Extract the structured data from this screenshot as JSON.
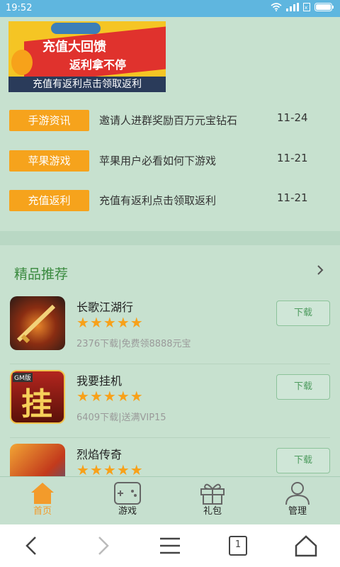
{
  "status_bar": {
    "time": "19:52"
  },
  "banner": {
    "headline_1": "充值大回馈",
    "headline_2": "返利拿不停",
    "caption": "充值有返利点击领取返利"
  },
  "news": [
    {
      "tag": "手游资讯",
      "title": "邀请人进群奖励百万元宝钻石",
      "date": "11-24"
    },
    {
      "tag": "苹果游戏",
      "title": "苹果用户必看如何下游戏",
      "date": "11-21"
    },
    {
      "tag": "充值返利",
      "title": "充值有返利点击领取返利",
      "date": "11-21"
    }
  ],
  "featured": {
    "title": "精品推荐",
    "more_icon": "chevron-right-icon",
    "apps": [
      {
        "name": "长歌江湖行",
        "rating": 5,
        "desc": "2376下载|免费领8888元宝",
        "download_label": "下载"
      },
      {
        "name": "我要挂机",
        "rating": 5,
        "desc": "6409下载|送满VIP15",
        "download_label": "下载"
      },
      {
        "name": "烈焰传奇",
        "rating": 5,
        "desc": "",
        "download_label": "下载"
      }
    ],
    "icon2_text": "挂",
    "icon2_badge": "GM版"
  },
  "tabbar": {
    "items": [
      {
        "label": "首页",
        "icon": "home-icon",
        "active": true
      },
      {
        "label": "游戏",
        "icon": "gamepad-icon",
        "active": false
      },
      {
        "label": "礼包",
        "icon": "gift-icon",
        "active": false
      },
      {
        "label": "管理",
        "icon": "user-icon",
        "active": false
      }
    ]
  },
  "browser_nav": {
    "tab_count": "1",
    "icons": [
      "back-icon",
      "forward-icon",
      "menu-icon",
      "tabs-icon",
      "home-icon"
    ]
  },
  "colors": {
    "background": "#c7e1cf",
    "status_bar": "#5fb6df",
    "accent_orange": "#f6a31c",
    "section_green": "#3a8a3f",
    "star": "#f7a11a"
  }
}
